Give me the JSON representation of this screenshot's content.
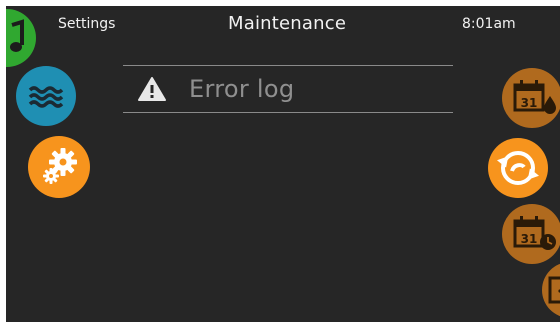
{
  "header": {
    "back_label": "Settings",
    "title": "Maintenance",
    "time": "8:01am"
  },
  "menu": {
    "items": [
      {
        "label": "Error log",
        "icon": "warning-icon"
      }
    ]
  },
  "left_nav": [
    {
      "icon": "music-icon",
      "color": "#30a830"
    },
    {
      "icon": "water-waves-icon",
      "color": "#1f8fb3"
    },
    {
      "icon": "gears-icon",
      "color": "#f7941d"
    }
  ],
  "right_nav": [
    {
      "icon": "calendar-water-icon",
      "calendar_day": "31",
      "color": "#b06a1e"
    },
    {
      "icon": "refresh-icon",
      "color": "#f7941d"
    },
    {
      "icon": "calendar-clock-icon",
      "calendar_day": "31",
      "color": "#b06a1e"
    },
    {
      "icon": "exit-icon",
      "color": "#b06a1e"
    }
  ],
  "colors": {
    "background": "#262626",
    "text": "#f2f2f2",
    "muted_text": "#8f8f8f",
    "accent_orange": "#f7941d",
    "dim_orange": "#b06a1e",
    "blue": "#1f8fb3",
    "green": "#30a830"
  }
}
